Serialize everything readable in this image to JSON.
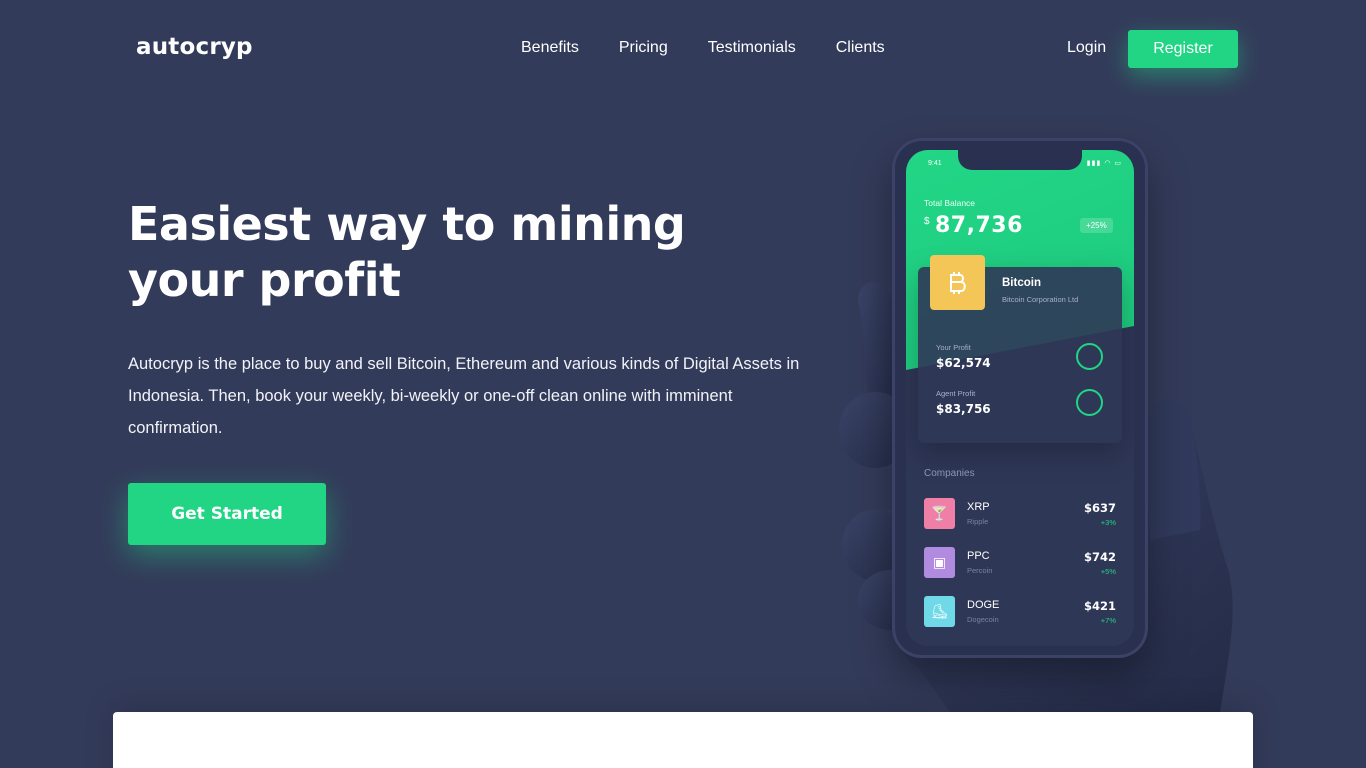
{
  "nav": {
    "logo": "autocryp",
    "links": [
      "Benefits",
      "Pricing",
      "Testimonials",
      "Clients"
    ],
    "login": "Login",
    "register": "Register"
  },
  "hero": {
    "title": "Easiest way to mining your profit",
    "description": "Autocryp is the place to buy and sell Bitcoin, Ethereum and various kinds of Digital Assets in Indonesia. Then, book your weekly, bi-weekly or one-off clean online with imminent confirmation.",
    "cta": "Get Started"
  },
  "phone": {
    "time": "9:41",
    "total_balance_label": "Total Balance",
    "currency_symbol": "$",
    "total_balance": "87,736",
    "balance_change": "+25%",
    "coin": {
      "name": "Bitcoin",
      "company": "Bitcoin Corporation Ltd",
      "your_profit_label": "Your Profit",
      "your_profit": "$62,574",
      "agent_profit_label": "Agent Profit",
      "agent_profit": "$83,756"
    },
    "companies_label": "Companies",
    "companies": [
      {
        "ticker": "XRP",
        "name": "Ripple",
        "price": "$637",
        "change": "+3%"
      },
      {
        "ticker": "PPC",
        "name": "Percoin",
        "price": "$742",
        "change": "+5%"
      },
      {
        "ticker": "DOGE",
        "name": "Dogecoin",
        "price": "$421",
        "change": "+7%"
      }
    ]
  },
  "colors": {
    "background": "#333b5a",
    "accent": "#21d585",
    "bitcoin": "#f3c657",
    "xrp": "#ef7fa6",
    "ppc": "#b18be0",
    "doge": "#6fd9e8"
  }
}
